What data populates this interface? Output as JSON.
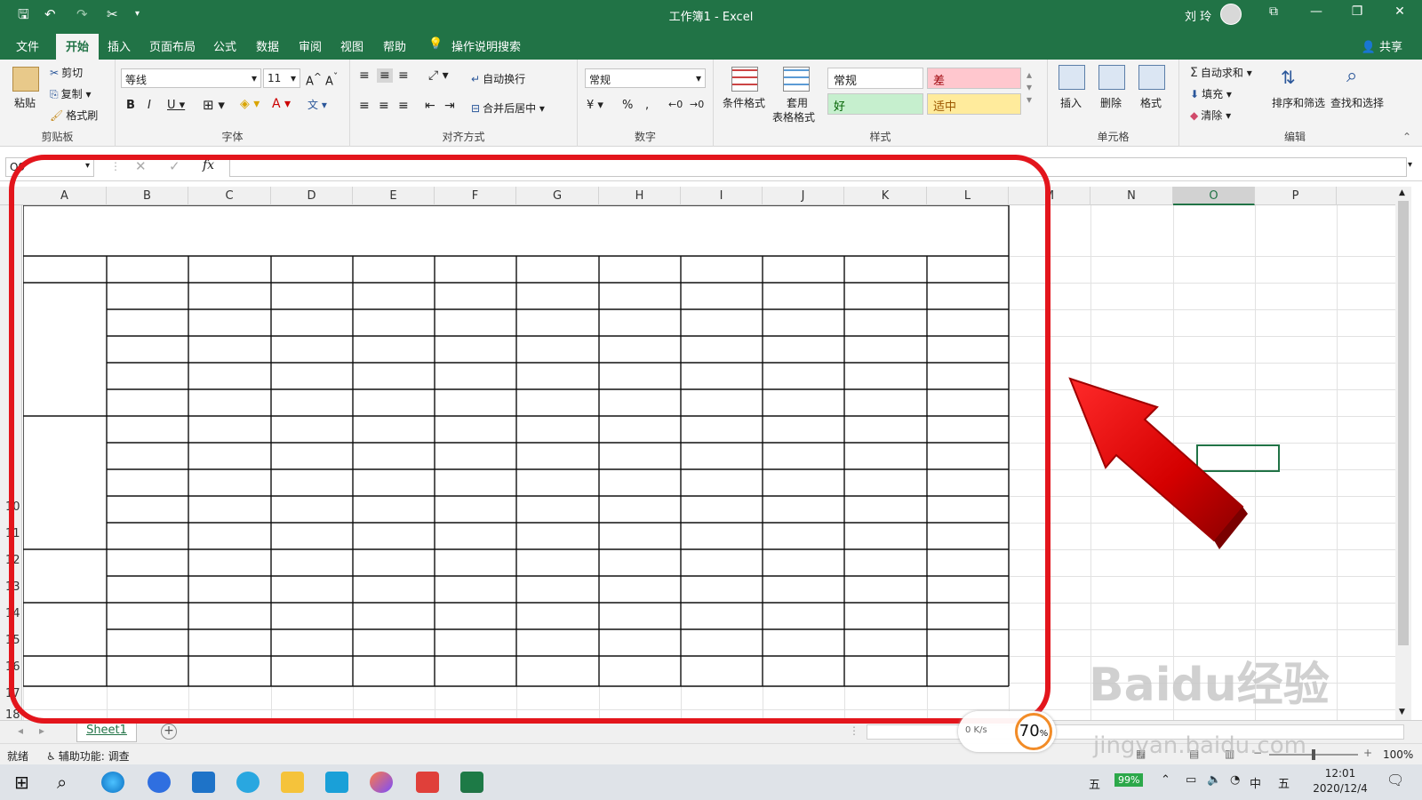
{
  "window": {
    "title": "工作簿1 - Excel",
    "user": "刘 玲"
  },
  "menu": {
    "tabs": [
      "文件",
      "开始",
      "插入",
      "页面布局",
      "公式",
      "数据",
      "审阅",
      "视图",
      "帮助"
    ],
    "active_tab": "开始",
    "search_label": "操作说明搜索",
    "share_label": "共享"
  },
  "ribbon": {
    "clipboard": {
      "paste": "粘贴",
      "cut": "剪切",
      "copy": "复制",
      "format_painter": "格式刷",
      "group": "剪贴板"
    },
    "font": {
      "name": "等线",
      "size": "11",
      "group": "字体"
    },
    "alignment": {
      "wrap": "自动换行",
      "merge": "合并后居中",
      "group": "对齐方式"
    },
    "number": {
      "format": "常规",
      "percent": "%",
      "comma": ",",
      "group": "数字"
    },
    "styles": {
      "conditional": "条件格式",
      "table_line1": "套用",
      "table_line2": "表格格式",
      "normal": "常规",
      "bad": "差",
      "good": "好",
      "neutral": "适中",
      "group": "样式"
    },
    "cells": {
      "insert": "插入",
      "delete": "删除",
      "format": "格式",
      "group": "单元格"
    },
    "editing": {
      "autosum": "自动求和",
      "fill": "填充",
      "clear": "清除",
      "sort": "排序和筛选",
      "find": "查找和选择",
      "group": "编辑"
    }
  },
  "formula_bar": {
    "name_box": "O9",
    "fx": "fx",
    "value": ""
  },
  "grid": {
    "columns": [
      "A",
      "B",
      "C",
      "D",
      "E",
      "F",
      "G",
      "H",
      "I",
      "J",
      "K",
      "L",
      "M",
      "N",
      "O",
      "P"
    ],
    "selected_column": "O",
    "rows": [
      "10",
      "11",
      "12",
      "13",
      "14",
      "15",
      "16",
      "17",
      "18"
    ]
  },
  "sheets": {
    "tabs": [
      "Sheet1"
    ],
    "add": "+"
  },
  "status": {
    "ready": "就绪",
    "accessibility": "辅助功能: 调查",
    "zoom": "100%"
  },
  "speed_widget": {
    "percent": "70",
    "unit": "%",
    "rate": "0 K/s"
  },
  "watermark": {
    "line1": "Baidu经验",
    "line2": "jingyan.baidu.com"
  },
  "taskbar": {
    "ime": "五",
    "battery": "99%",
    "lang": "中",
    "ime2": "五",
    "time": "12:01",
    "date": "2020/12/4"
  },
  "colors": {
    "excel_green": "#217346",
    "annotation_red": "#e3151c"
  }
}
